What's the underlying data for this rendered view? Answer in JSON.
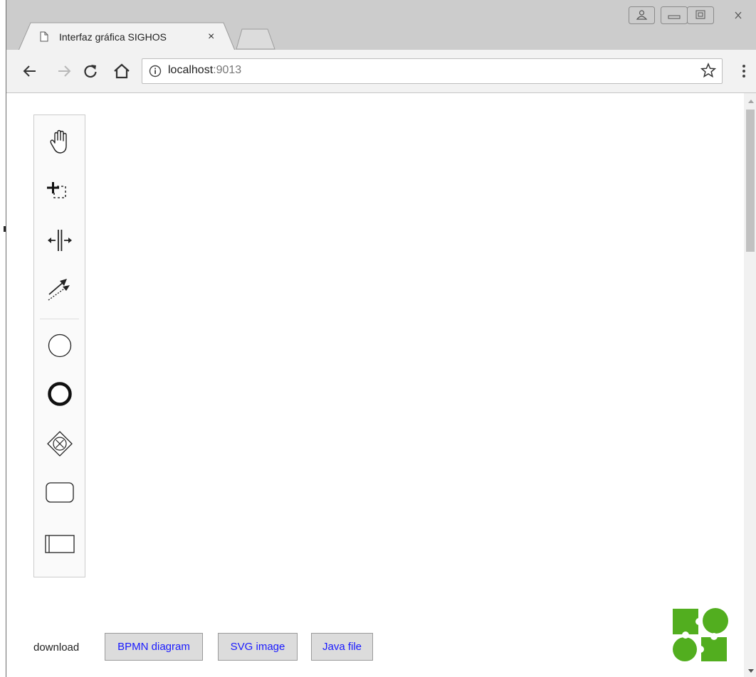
{
  "browser": {
    "tab_title": "Interfaz gráfica SIGHOS",
    "tab_close": "×",
    "url_host": "localhost",
    "url_port": ":9013"
  },
  "palette": {
    "tools": [
      {
        "name": "hand-tool",
        "icon": "hand-icon"
      },
      {
        "name": "lasso-tool",
        "icon": "lasso-icon"
      },
      {
        "name": "space-tool",
        "icon": "space-icon"
      },
      {
        "name": "global-connect-tool",
        "icon": "connect-icon"
      },
      {
        "name": "start-event",
        "icon": "start-event-icon"
      },
      {
        "name": "end-event",
        "icon": "end-event-icon"
      },
      {
        "name": "exclusive-gateway",
        "icon": "gateway-xor-icon"
      },
      {
        "name": "task",
        "icon": "task-icon"
      },
      {
        "name": "participant",
        "icon": "participant-icon"
      }
    ]
  },
  "download": {
    "label": "download",
    "bpmn_button": "BPMN diagram",
    "svg_button": "SVG image",
    "java_button": "Java file"
  },
  "colors": {
    "link": "#1a1aff",
    "logo_green": "#52ae1f",
    "chrome_bg": "#cccccc",
    "toolbar_bg": "#f2f2f2"
  }
}
